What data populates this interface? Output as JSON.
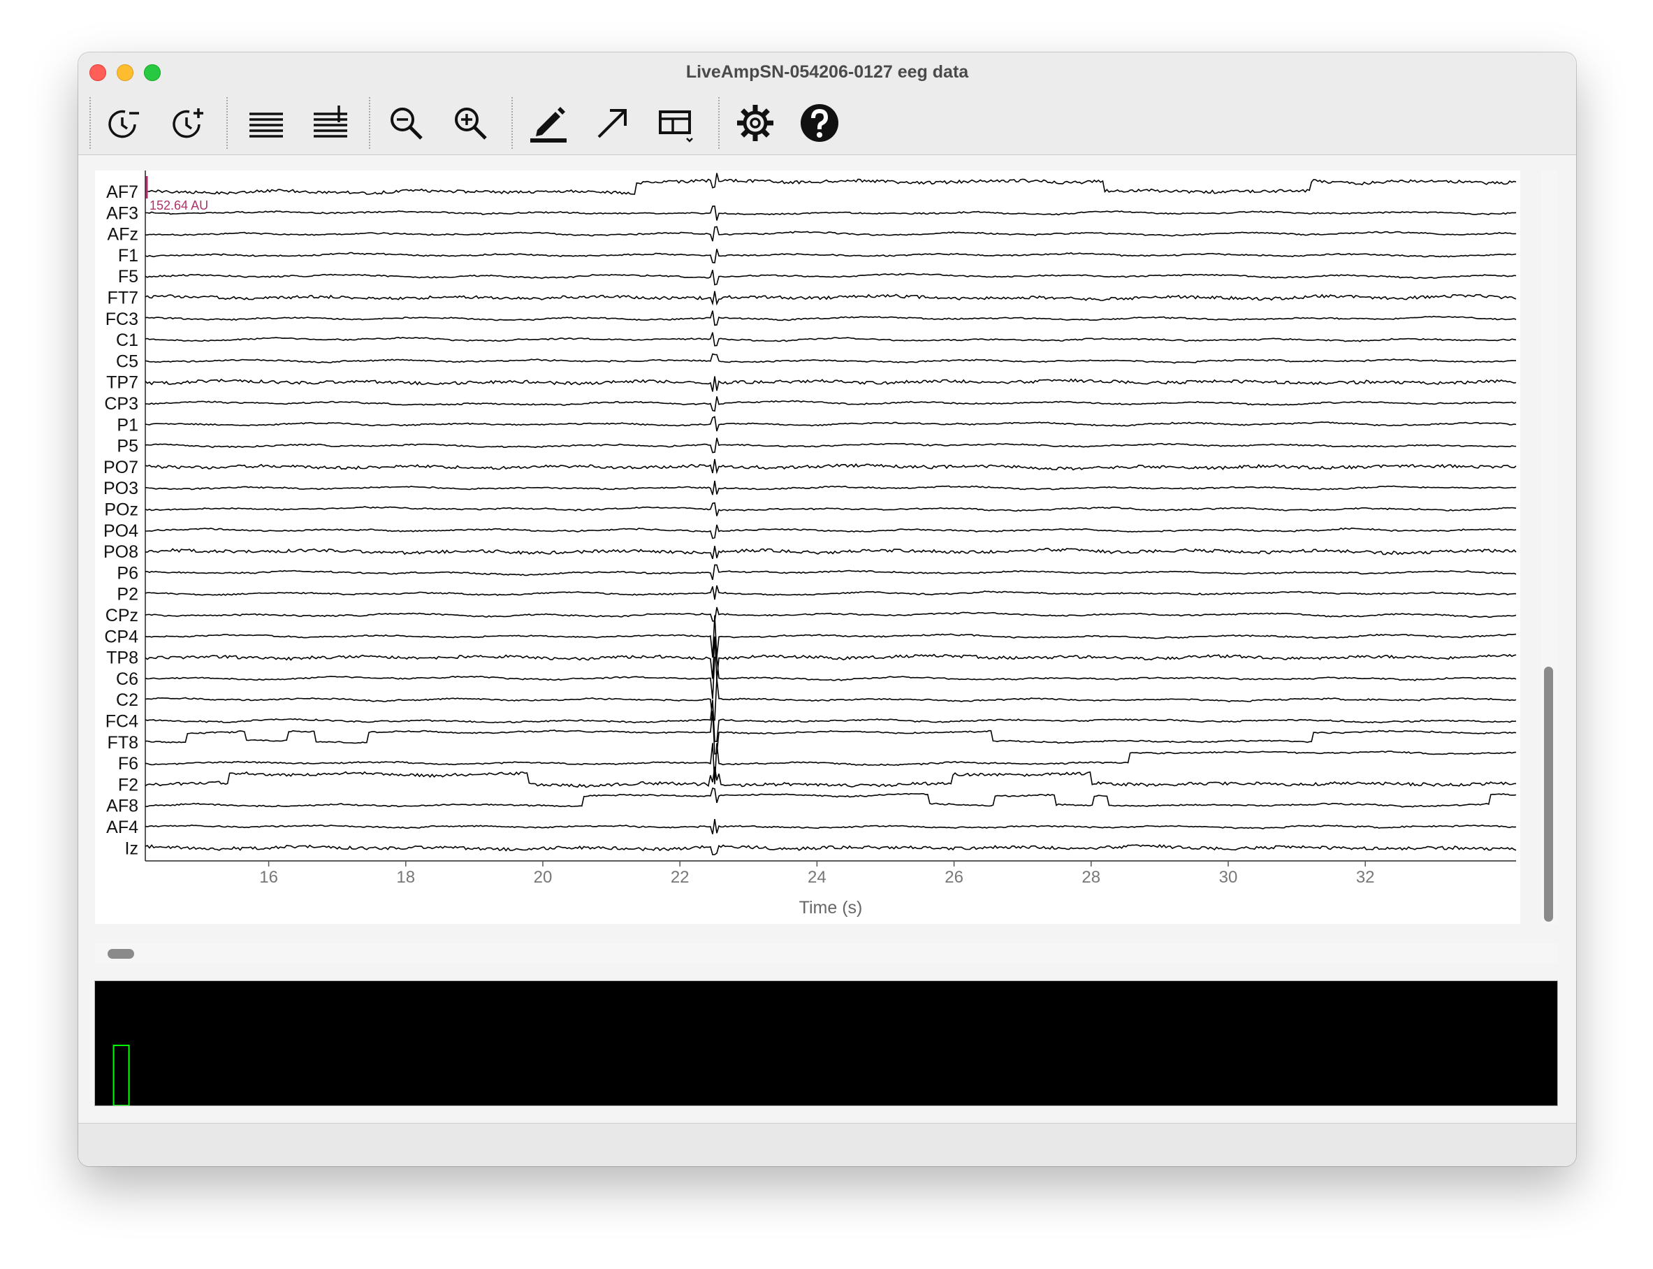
{
  "window": {
    "title": "LiveAmpSN-054206-0127 eeg data"
  },
  "toolbar": {
    "buttons": [
      {
        "name": "decrease-time-scale-button",
        "icon": "clock-minus-icon"
      },
      {
        "name": "increase-time-scale-button",
        "icon": "clock-plus-icon"
      },
      {
        "name": "decrease-channels-button",
        "icon": "lines-icon"
      },
      {
        "name": "increase-channels-button",
        "icon": "lines-plus-icon"
      },
      {
        "name": "zoom-out-button",
        "icon": "zoom-out-icon"
      },
      {
        "name": "zoom-in-button",
        "icon": "zoom-in-icon"
      },
      {
        "name": "annotate-button",
        "icon": "pen-icon"
      },
      {
        "name": "event-arrow-button",
        "icon": "arrow-up-right-icon"
      },
      {
        "name": "layout-button",
        "icon": "layout-grid-icon"
      },
      {
        "name": "settings-button",
        "icon": "gear-icon"
      },
      {
        "name": "help-button",
        "icon": "question-icon"
      }
    ]
  },
  "colors": {
    "trace": "#000000",
    "scale_bar": "#b0306a",
    "overview_bg": "#000000",
    "overview_marker": "#00ff00",
    "scrollbar_thumb": "#8a8a8a"
  },
  "chart_data": {
    "type": "line",
    "title": "",
    "xlabel": "Time (s)",
    "ylabel": "",
    "xlim": [
      14.2,
      34.2
    ],
    "xticks": [
      "16",
      "18",
      "20",
      "22",
      "24",
      "26",
      "28",
      "30",
      "32"
    ],
    "scale_label": "152.64 AU",
    "channels": [
      "AF7",
      "AF3",
      "AFz",
      "F1",
      "F5",
      "FT7",
      "FC3",
      "C1",
      "C5",
      "TP7",
      "CP3",
      "P1",
      "P5",
      "PO7",
      "PO3",
      "POz",
      "PO4",
      "PO8",
      "P6",
      "P2",
      "CPz",
      "CP4",
      "TP8",
      "C6",
      "C2",
      "FC4",
      "FT8",
      "F6",
      "F2",
      "AF8",
      "AF4",
      "Iz"
    ],
    "grid": false,
    "legend": "none",
    "events": [
      {
        "label": "spike",
        "t": 22.5
      }
    ]
  },
  "overview": {
    "marker_position": 0.006
  }
}
